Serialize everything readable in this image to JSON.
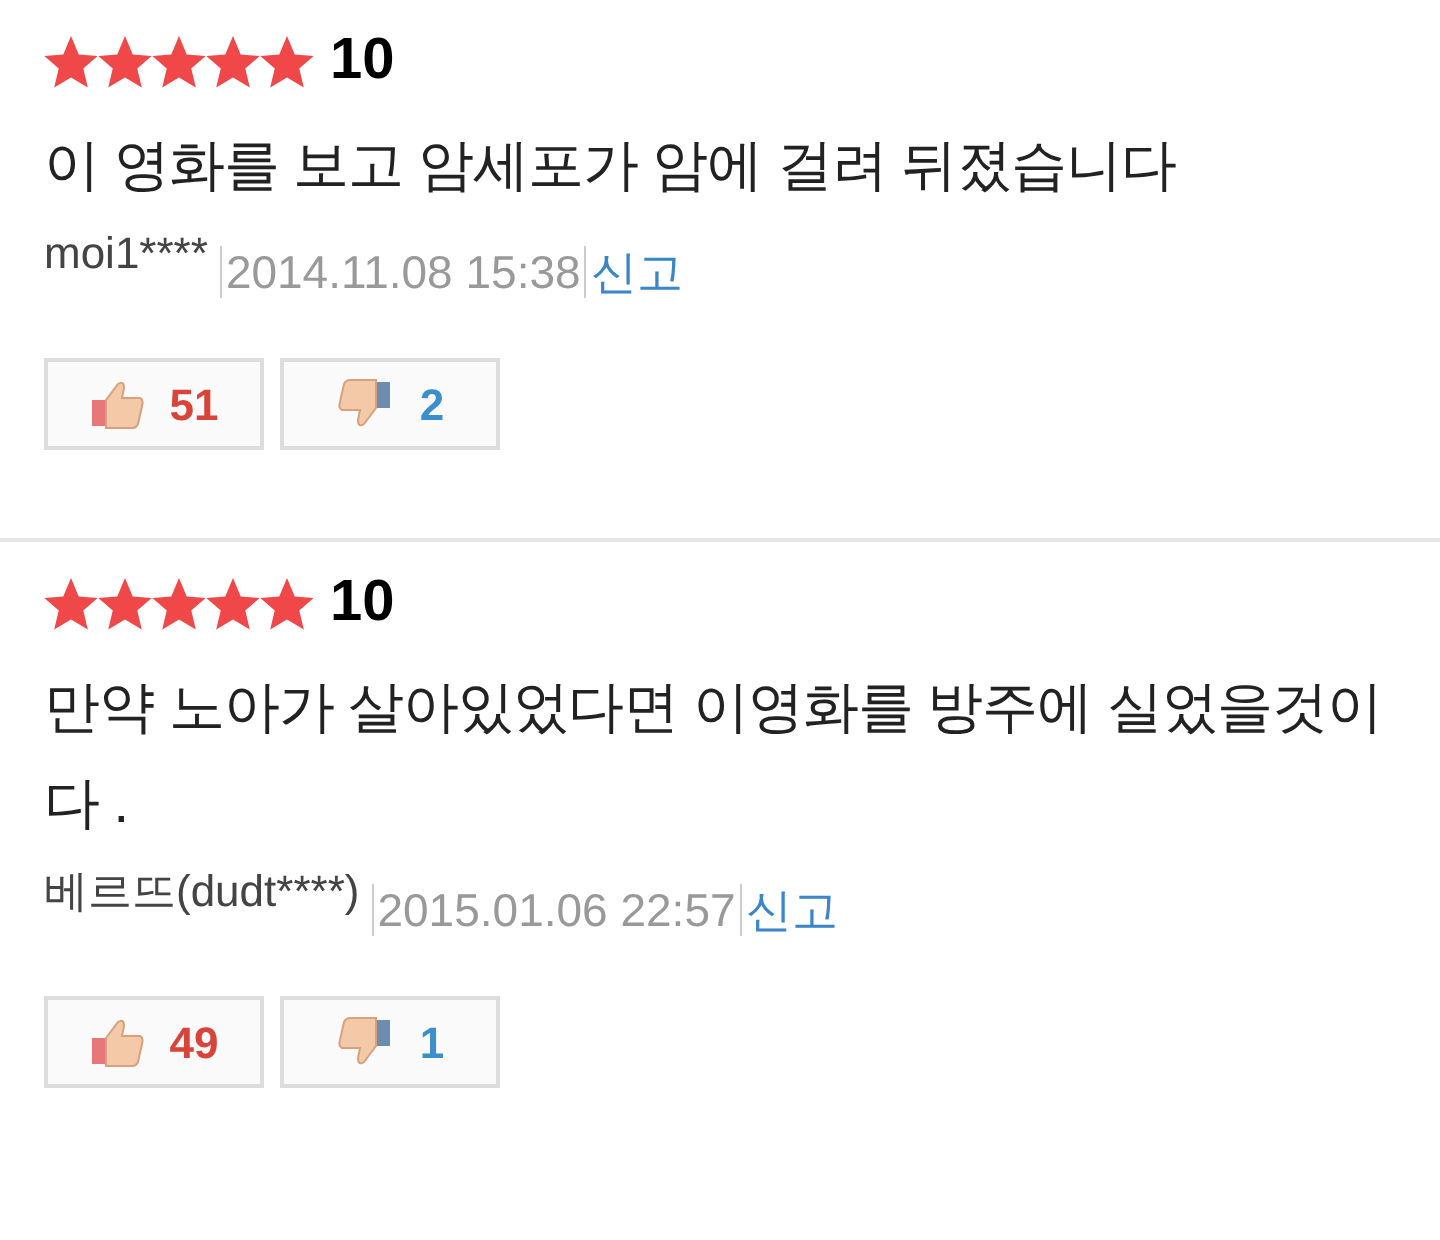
{
  "reviews": [
    {
      "stars": 5,
      "score": "10",
      "comment": "이 영화를 보고 암세포가 암에 걸려 뒤졌습니다",
      "author": "moi1****",
      "date": "2014.11.08 15:38",
      "report": "신고",
      "likes": "51",
      "dislikes": "2"
    },
    {
      "stars": 5,
      "score": "10",
      "comment": "만약 노아가 살아있었다면 이영화를 방주에 실었을것이다 .",
      "author": "베르뜨(dudt****)",
      "date": "2015.01.06 22:57",
      "report": "신고",
      "likes": "49",
      "dislikes": "1"
    }
  ]
}
